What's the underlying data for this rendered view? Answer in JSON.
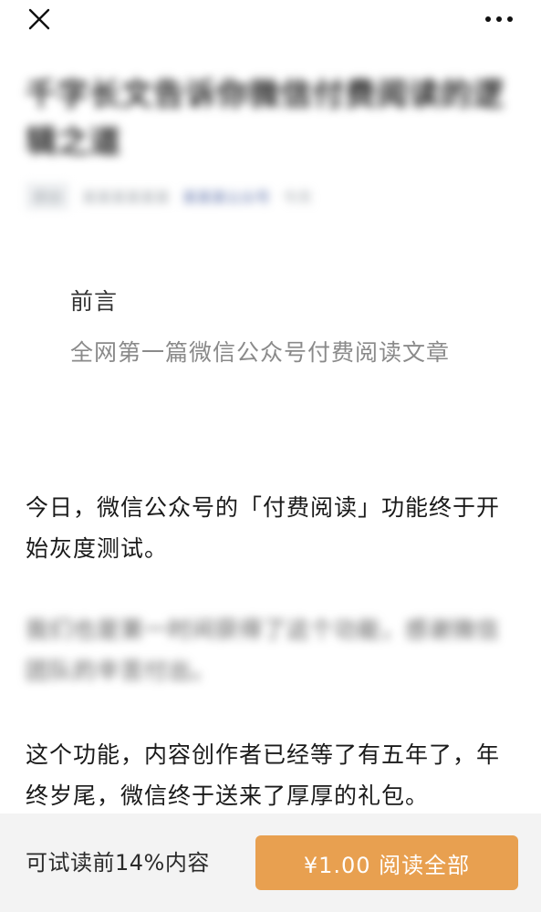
{
  "topbar": {
    "close_icon": "close-icon",
    "more_icon": "more-dots-icon"
  },
  "article": {
    "title": "千字长文告诉你微信付费阅读的逻辑之道",
    "meta": {
      "tag": "原创",
      "author": "某某某某某某",
      "account": "某某某公众号",
      "extra": "今天"
    },
    "preface": {
      "title": "前言",
      "desc": "全网第一篇微信公众号付费阅读文章"
    },
    "paragraphs": [
      "今日，微信公众号的「付费阅读」功能终于开始灰度测试。",
      "我们也是第一时间获得了这个功能，感谢微信团队的辛苦付出。",
      "这个功能，内容创作者已经等了有五年了，年终岁尾，微信终于送来了厚厚的礼包。"
    ]
  },
  "paybar": {
    "trial_text": "可试读前14%内容",
    "pay_label": "¥1.00 阅读全部"
  },
  "colors": {
    "accent": "#e8a050",
    "paybar_bg": "#f3f3f3",
    "muted_text": "#8a8a8a"
  }
}
